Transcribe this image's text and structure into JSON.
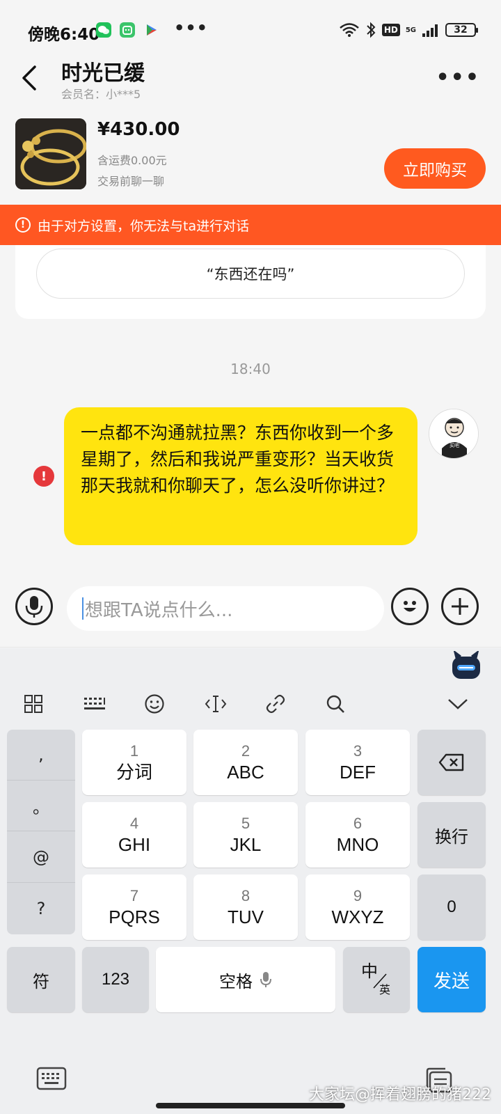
{
  "status_bar": {
    "time": "傍晚6:40",
    "more": "•••",
    "hd_label": "HD",
    "network_label": "5G",
    "battery": "32"
  },
  "header": {
    "shop_name": "时光已缓",
    "member_label": "会员名：小***5",
    "more": "•••"
  },
  "product": {
    "price": "¥430.00",
    "shipping": "含运费0.00元",
    "chat_hint": "交易前聊一聊",
    "buy_label": "立即购买"
  },
  "warning": {
    "text": "由于对方设置，你无法与ta进行对话",
    "icon_text": "!"
  },
  "quick_reply": "“东西还在吗”",
  "chat": {
    "timestamp": "18:40",
    "message": "一点都不沟通就拉黑？东西你收到一个多星期了，然后和我说严重变形？当天收货那天我就和你聊天了，怎么没听你讲过？",
    "error_icon_text": "!",
    "avatar_caption": "买吧"
  },
  "input": {
    "placeholder": "想跟TA说点什么..."
  },
  "keyboard": {
    "punct": [
      ",",
      "。",
      "@",
      "?"
    ],
    "keys": [
      {
        "num": "1",
        "letters": "分词"
      },
      {
        "num": "2",
        "letters": "ABC"
      },
      {
        "num": "3",
        "letters": "DEF"
      },
      {
        "num": "4",
        "letters": "GHI"
      },
      {
        "num": "5",
        "letters": "JKL"
      },
      {
        "num": "6",
        "letters": "MNO"
      },
      {
        "num": "7",
        "letters": "PQRS"
      },
      {
        "num": "8",
        "letters": "TUV"
      },
      {
        "num": "9",
        "letters": "WXYZ"
      }
    ],
    "newline": "换行",
    "zero": "0",
    "symbols": "符",
    "numbers": "123",
    "space": "空格",
    "lang_top": "中",
    "lang_bottom": "英",
    "send": "发送"
  },
  "watermark": "大家坛@挥着翅膀的猪222"
}
